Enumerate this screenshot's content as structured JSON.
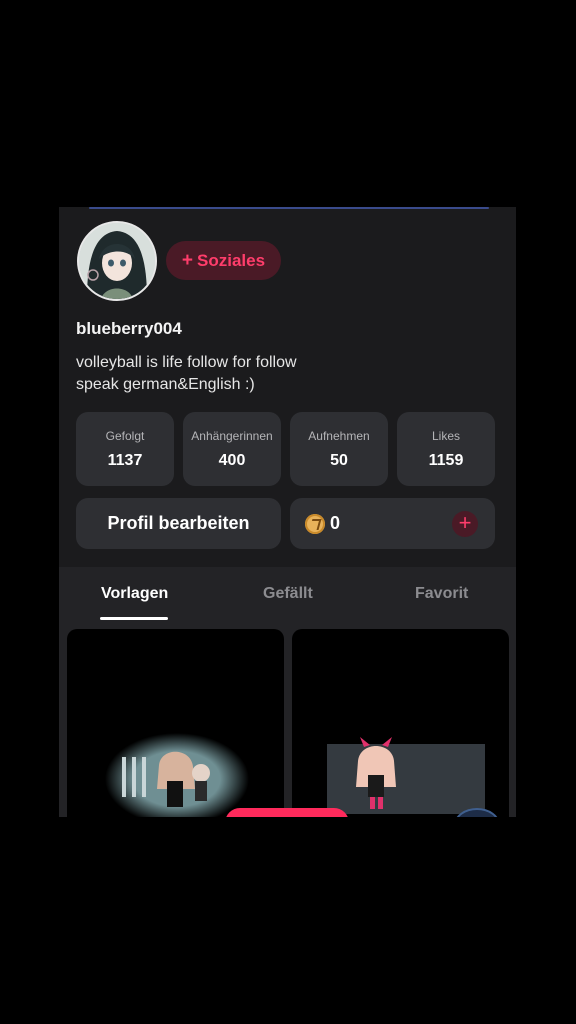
{
  "profile": {
    "social_button_label": "Soziales",
    "username": "blueberry004",
    "bio_line1": "volleyball is life follow for follow",
    "bio_line2": "speak german&English :)"
  },
  "stats": [
    {
      "label": "Gefolgt",
      "value": "1137"
    },
    {
      "label": "Anhängerinnen",
      "value": "400"
    },
    {
      "label": "Aufnehmen",
      "value": "50"
    },
    {
      "label": "Likes",
      "value": "1159"
    }
  ],
  "actions": {
    "edit_profile_label": "Profil bearbeiten",
    "coins": "0"
  },
  "tabs": [
    {
      "label": "Vorlagen",
      "active": true
    },
    {
      "label": "Gefällt",
      "active": false
    },
    {
      "label": "Favorit",
      "active": false
    }
  ],
  "colors": {
    "accent": "#ff3d6b",
    "background": "#1b1b1d",
    "card": "#2e2f33"
  }
}
